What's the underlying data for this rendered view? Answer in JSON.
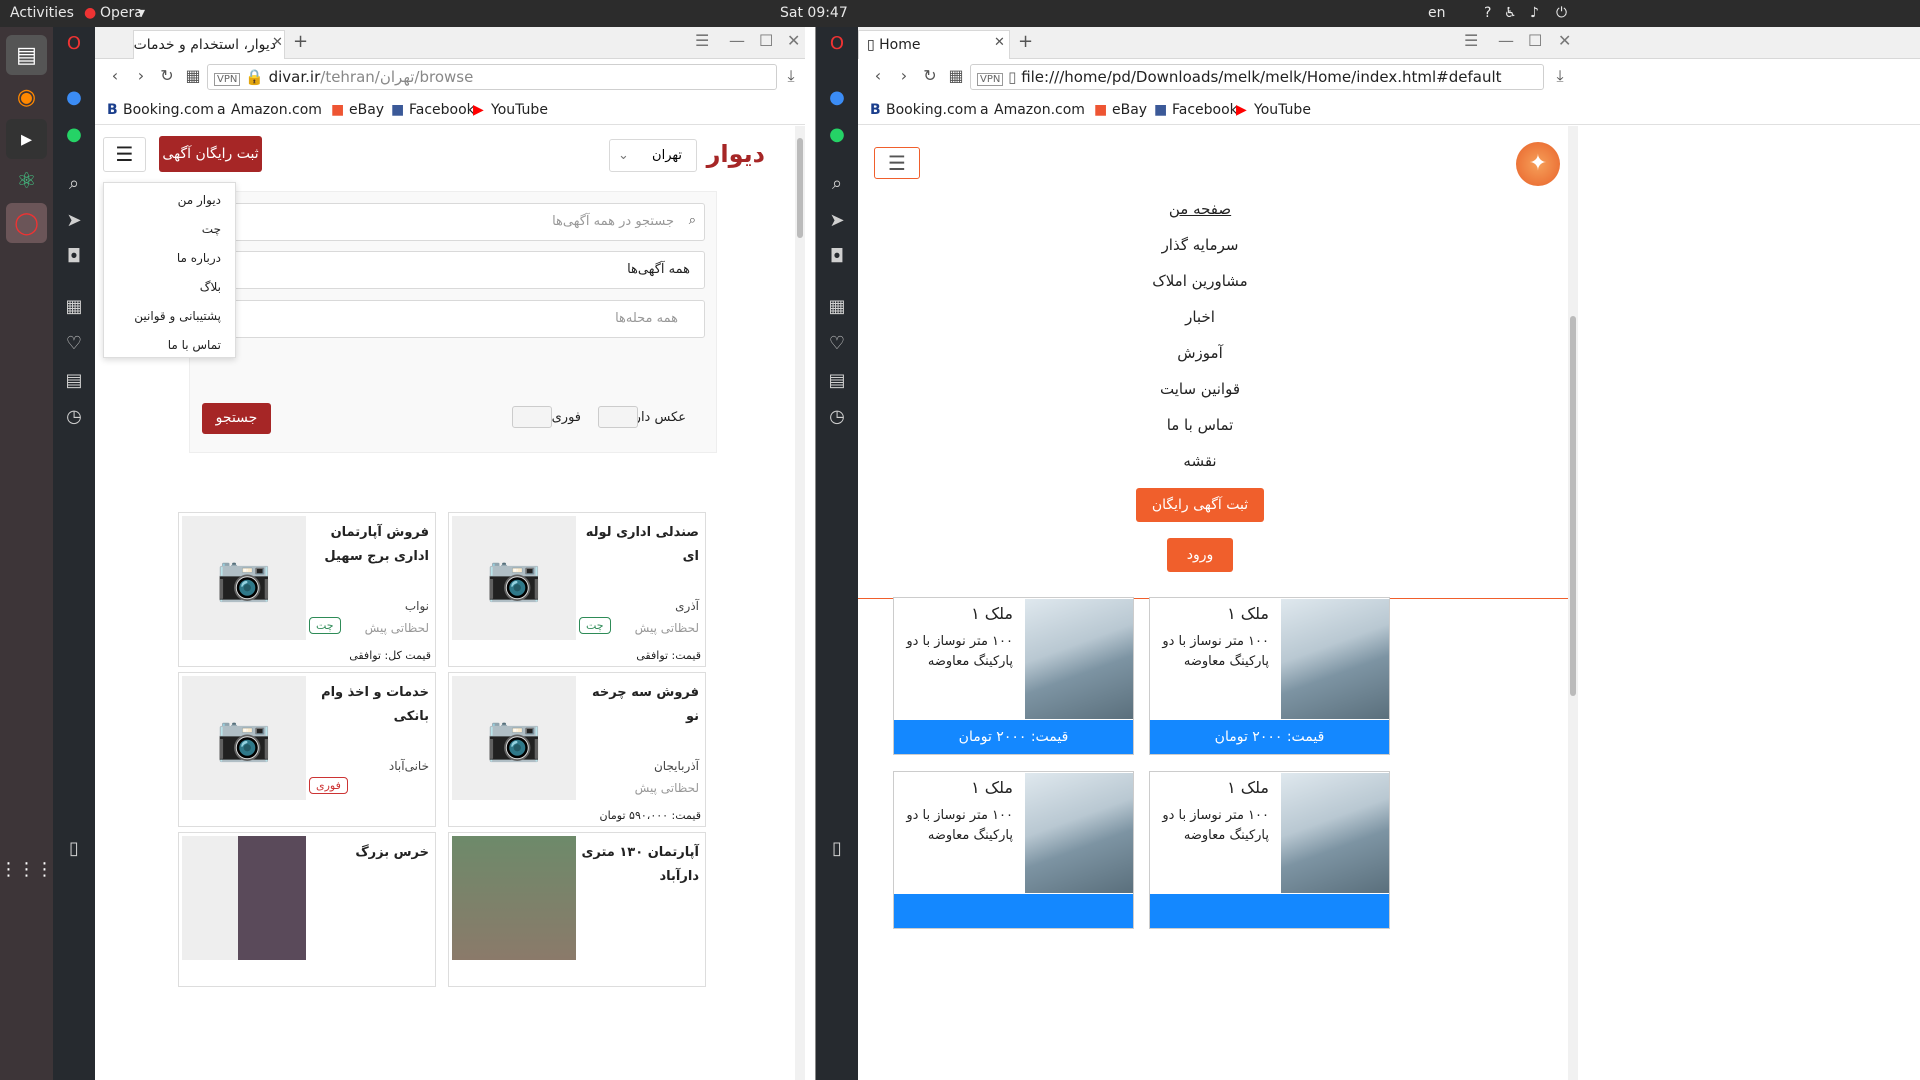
{
  "system": {
    "activities": "Activities",
    "app": "Opera",
    "clock": "Sat 09:47",
    "lang": "en"
  },
  "left_window": {
    "tab_title": "دیوار، استخدام و خدمات",
    "url_host": "divar.ir",
    "url_path": "/tehran/تهران/browse",
    "bookmarks": [
      "Booking.com",
      "Amazon.com",
      "eBay",
      "Facebook",
      "YouTube"
    ],
    "page": {
      "logo": "دیوار",
      "city": "تهران",
      "post_ad": "ثبت رایگان آگهی",
      "menu": [
        "دیوار من",
        "چت",
        "درباره ما",
        "بلاگ",
        "پشتیبانی و قوانین",
        "تماس با ما"
      ],
      "search_placeholder": "جستجو در همه آگهی‌ها",
      "category": "همه آگهی‌ها",
      "district_placeholder": "همه محله‌ها",
      "photo_toggle": "عکس دار",
      "urgent_toggle": "فوری",
      "search_btn": "جستجو",
      "cards": [
        {
          "title": "صندلی اداری لوله ای",
          "loc": "آذری",
          "ago": "لحظاتی پیش",
          "price": "قیمت: توافقی",
          "badge": "چت"
        },
        {
          "title": "فروش آپارتمان اداری برج سهیل",
          "loc": "نواب",
          "ago": "لحظاتی پیش",
          "price": "قیمت کل: توافقی",
          "badge": "چت"
        },
        {
          "title": "فروش سه چرخه نو",
          "loc": "آذربایجان",
          "ago": "لحظاتی پیش",
          "price": "قیمت: ۵۹۰،۰۰۰ تومان",
          "badge": ""
        },
        {
          "title": "خدمات و اخذ وام بانکی",
          "loc": "خانی‌آباد",
          "ago": "",
          "price": "",
          "badge": "فوری"
        },
        {
          "title": "آپارتمان ۱۳۰ متری دارآباد",
          "loc": "",
          "ago": "",
          "price": "",
          "badge": ""
        },
        {
          "title": "خرس بزرگ",
          "loc": "",
          "ago": "",
          "price": "",
          "badge": ""
        }
      ]
    }
  },
  "right_window": {
    "tab_title": "Home",
    "url": "file:///home/pd/Downloads/melk/melk/Home/index.html#default",
    "bookmarks": [
      "Booking.com",
      "Amazon.com",
      "eBay",
      "Facebook",
      "YouTube"
    ],
    "page": {
      "nav": [
        "صفحه من",
        "سرمایه گذار",
        "مشاورین املاک",
        "اخبار",
        "آموزش",
        "قوانین سایت",
        "تماس با ما",
        "نقشه"
      ],
      "post_ad": "ثبت آگهی رایگان",
      "login": "ورود",
      "properties": [
        {
          "name": "ملک ۱",
          "desc": "۱۰۰ متر نوساز با دو پارکینگ معاوضه",
          "price": "قیمت: ۲۰۰۰ تومان"
        },
        {
          "name": "ملک ۱",
          "desc": "۱۰۰ متر نوساز با دو پارکینگ معاوضه",
          "price": "قیمت: ۲۰۰۰ تومان"
        },
        {
          "name": "ملک ۱",
          "desc": "۱۰۰ متر نوساز با دو پارکینگ معاوضه",
          "price": ""
        },
        {
          "name": "ملک ۱",
          "desc": "۱۰۰ متر نوساز با دو پارکینگ معاوضه",
          "price": ""
        }
      ]
    }
  },
  "colors": {
    "divar_red": "#a62626",
    "melk_orange": "#f05f2c",
    "price_blue": "#1488ff"
  }
}
